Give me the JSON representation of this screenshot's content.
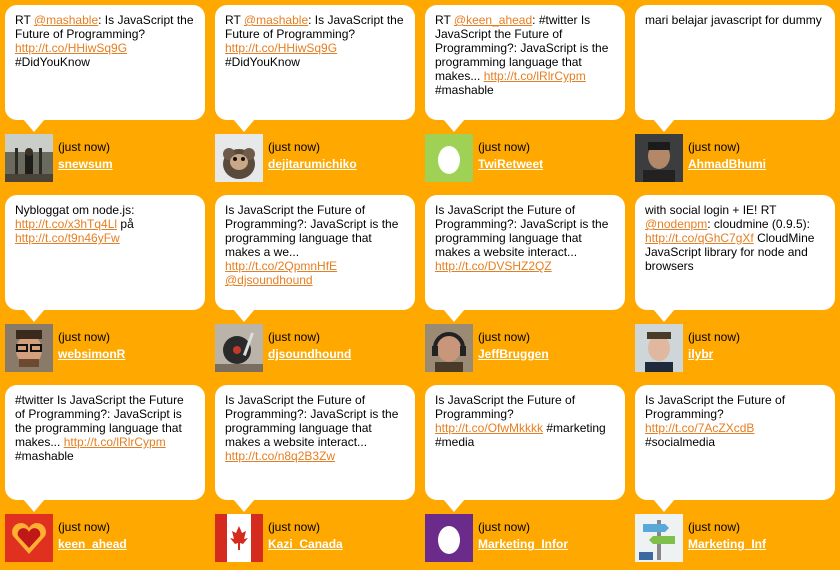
{
  "tweets": [
    {
      "text": [
        {
          "t": "RT "
        },
        {
          "t": "@mashable",
          "link": true
        },
        {
          "t": ": Is JavaScript the Future of Programming? "
        },
        {
          "t": "http://t.co/HHiwSq9G",
          "link": true
        },
        {
          "t": " #DidYouKnow"
        }
      ],
      "time": "(just now)",
      "user": "snewsum",
      "avatar": "bridge-photo-avatar"
    },
    {
      "text": [
        {
          "t": "RT "
        },
        {
          "t": "@mashable",
          "link": true
        },
        {
          "t": ": Is JavaScript the Future of Programming? "
        },
        {
          "t": "http://t.co/HHiwSq9G",
          "link": true
        },
        {
          "t": " #DidYouKnow"
        }
      ],
      "time": "(just now)",
      "user": "dejitarumichiko",
      "avatar": "monkey-photo-avatar"
    },
    {
      "text": [
        {
          "t": "RT "
        },
        {
          "t": "@keen_ahead",
          "link": true
        },
        {
          "t": ": #twitter Is JavaScript the Future of Programming?: JavaScript is the programming language that makes... "
        },
        {
          "t": "http://t.co/lRlrCypm",
          "link": true
        },
        {
          "t": " #mashable"
        }
      ],
      "time": "(just now)",
      "user": "TwiRetweet",
      "avatar": "default-egg-avatar"
    },
    {
      "text": [
        {
          "t": "mari belajar javascript for dummy"
        }
      ],
      "time": "(just now)",
      "user": "AhmadBhumi",
      "avatar": "man-portrait-avatar"
    },
    {
      "text": [
        {
          "t": "Nybloggat om node.js: "
        },
        {
          "t": "http://t.co/x3hTq4Ll",
          "link": true
        },
        {
          "t": " på "
        },
        {
          "t": "http://t.co/t9n46yFw",
          "link": true
        }
      ],
      "time": "(just now)",
      "user": "websimonR",
      "avatar": "man-glasses-avatar"
    },
    {
      "text": [
        {
          "t": "Is JavaScript the Future of Programming?: JavaScript is the programming language that makes a we... "
        },
        {
          "t": "http://t.co/2QpmnHfE",
          "link": true
        },
        {
          "t": " "
        },
        {
          "t": "@djsoundhound",
          "link": true
        }
      ],
      "time": "(just now)",
      "user": "djsoundhound",
      "avatar": "turntable-avatar"
    },
    {
      "text": [
        {
          "t": "Is JavaScript the Future of Programming?: JavaScript is the programming language that makes a website interact... "
        },
        {
          "t": "http://t.co/DVSHZ2QZ",
          "link": true
        }
      ],
      "time": "(just now)",
      "user": "JeffBruggen",
      "avatar": "man-headphones-avatar"
    },
    {
      "text": [
        {
          "t": "with social login + IE! RT "
        },
        {
          "t": "@nodenpm",
          "link": true
        },
        {
          "t": ": cloudmine (0.9.5): "
        },
        {
          "t": "http://t.co/qGhC7gXf",
          "link": true
        },
        {
          "t": " CloudMine JavaScript library for node and browsers"
        }
      ],
      "time": "(just now)",
      "user": "ilybr",
      "avatar": "young-man-avatar"
    },
    {
      "text": [
        {
          "t": "#twitter Is JavaScript the Future of Programming?: JavaScript is the programming language that makes... "
        },
        {
          "t": "http://t.co/lRlrCypm",
          "link": true
        },
        {
          "t": " #mashable"
        }
      ],
      "time": "(just now)",
      "user": "keen_ahead",
      "avatar": "heart-avatar"
    },
    {
      "text": [
        {
          "t": "Is JavaScript the Future of Programming?: JavaScript is the programming language that makes a website interact... "
        },
        {
          "t": "http://t.co/n8q2B3Zw",
          "link": true
        }
      ],
      "time": "(just now)",
      "user": "Kazi_Canada",
      "avatar": "canada-flag-avatar"
    },
    {
      "text": [
        {
          "t": "Is JavaScript the Future of Programming? "
        },
        {
          "t": "http://t.co/OfwMkkkk",
          "link": true
        },
        {
          "t": " #marketing #media"
        }
      ],
      "time": "(just now)",
      "user": "Marketing_Infor",
      "avatar": "purple-egg-avatar"
    },
    {
      "text": [
        {
          "t": "Is JavaScript the Future of Programming? "
        },
        {
          "t": "http://t.co/7AcZXcdB",
          "link": true
        },
        {
          "t": " #socialmedia"
        }
      ],
      "time": "(just now)",
      "user": "Marketing_Inf",
      "avatar": "signpost-avatar"
    }
  ],
  "colors": {
    "background": "#FFA800",
    "link": "#E67E22",
    "username": "#FFFFFF",
    "bubble": "#FFFFFF"
  }
}
